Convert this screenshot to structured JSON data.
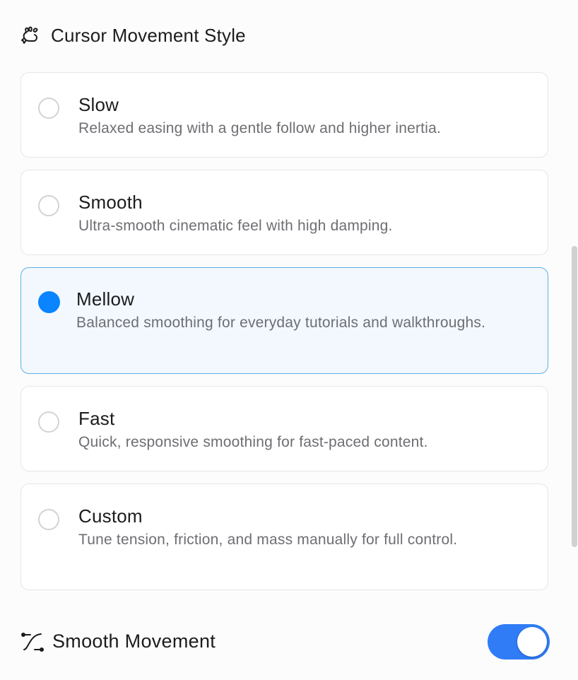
{
  "header": {
    "title": "Cursor Movement Style",
    "icon": "paw-cursor-icon"
  },
  "options": [
    {
      "title": "Slow",
      "description": "Relaxed easing with a gentle follow and higher inertia.",
      "selected": false
    },
    {
      "title": "Smooth",
      "description": "Ultra-smooth cinematic feel with high damping.",
      "selected": false
    },
    {
      "title": "Mellow",
      "description": "Balanced smoothing for everyday tutorials and walkthroughs.",
      "selected": true
    },
    {
      "title": "Fast",
      "description": "Quick, responsive smoothing for fast-paced content.",
      "selected": false
    },
    {
      "title": "Custom",
      "description": "Tune tension, friction, and mass manually for full control.",
      "selected": false
    }
  ],
  "footer": {
    "label": "Smooth Movement",
    "icon": "bezier-curve-icon",
    "toggle_on": true
  },
  "colors": {
    "accent": "#0a84ff",
    "toggle": "#2f7cf6",
    "selected_border": "#5cb0e4",
    "selected_bg": "#f2f8fe"
  }
}
